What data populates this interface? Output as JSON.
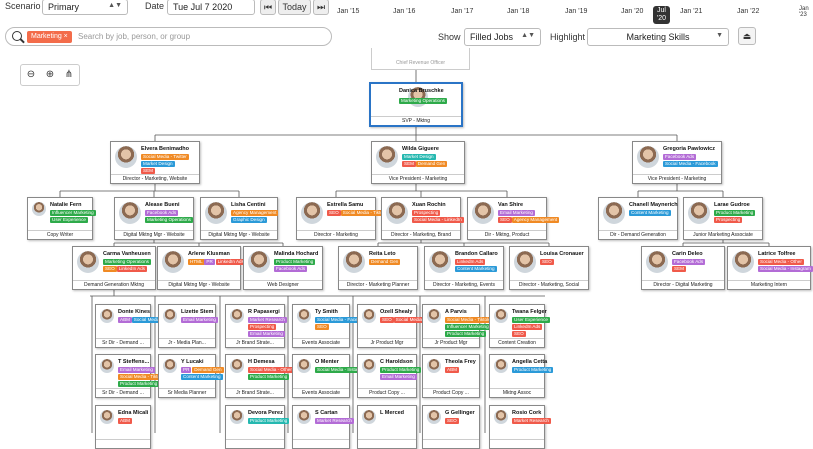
{
  "toolbar": {
    "scenario_label": "Scenario",
    "scenario_value": "Primary",
    "date_label": "Date",
    "date_value": "Tue Jul 7 2020",
    "today_label": "Today"
  },
  "timeline": {
    "ticks": [
      "Jan '15",
      "Jan '16",
      "Jan '17",
      "Jan '18",
      "Jan '19",
      "Jan '20",
      "Jan '21",
      "Jan '22",
      "Jan '23"
    ],
    "current": "Jul '20"
  },
  "search": {
    "tag": "Marketing ×",
    "placeholder": "Search by job, person, or group"
  },
  "show": {
    "label": "Show",
    "value": "Filled Jobs"
  },
  "highlight": {
    "label": "Highlight",
    "value": "Marketing Skills"
  },
  "ghost_title": "Chief Revenue Officer",
  "colors": {
    "green": "#2eaa4a",
    "red": "#f05a4a",
    "orange": "#f08a24",
    "blue": "#2b9ad8",
    "purple": "#b36cd6",
    "teal": "#25b8b0",
    "selected": "#2a74c6"
  },
  "cards": [
    {
      "name": "Danica Bruschke",
      "title": "SVP - Mktng",
      "tags": [
        [
          "Marketing Operations",
          "green"
        ]
      ]
    },
    {
      "name": "Elvera Benimadho",
      "title": "Director - Marketing, Website",
      "tags": [
        [
          "Social Media - Twitter",
          "orange"
        ],
        [
          "Market Design",
          "blue"
        ],
        [
          "SEM",
          "red"
        ]
      ]
    },
    {
      "name": "Wilda Giguere",
      "title": "Vice President - Marketing",
      "tags": [
        [
          "Market Design",
          "teal"
        ],
        [
          "SEM",
          "red"
        ],
        [
          "Demand Gen",
          "orange"
        ]
      ]
    },
    {
      "name": "Gregoria Pawlowicz",
      "title": "Vice President - Marketing",
      "tags": [
        [
          "Facebook Ads",
          "purple"
        ],
        [
          "Social Media - Facebook",
          "blue"
        ]
      ]
    },
    {
      "name": "Natalie Fern",
      "title": "Copy Writer",
      "tags": [
        [
          "Influencer Marketing",
          "green"
        ],
        [
          "User Experience",
          "green"
        ]
      ]
    },
    {
      "name": "Alease Bueni",
      "title": "Digital Mktng Mgr - Website",
      "tags": [
        [
          "Facebook Ads",
          "purple"
        ],
        [
          "Marketing Operations",
          "green"
        ]
      ]
    },
    {
      "name": "Lisha Centini",
      "title": "Digital Mktng Mgr - Website",
      "tags": [
        [
          "Agency Management",
          "orange"
        ],
        [
          "Graphic Design",
          "blue"
        ]
      ]
    },
    {
      "name": "Estrella Samu",
      "title": "Director - Marketing",
      "tags": [
        [
          "SEO",
          "red"
        ],
        [
          "Social Media - Tiktok",
          "orange"
        ]
      ]
    },
    {
      "name": "Xuan Rochin",
      "title": "Director - Marketing, Brand",
      "tags": [
        [
          "Prospecting",
          "red"
        ],
        [
          "Social Media - LinkedIn",
          "red"
        ]
      ]
    },
    {
      "name": "Van Shire",
      "title": "Dir - Mktng, Product",
      "tags": [
        [
          "Email Marketing",
          "purple"
        ],
        [
          "SEO",
          "red"
        ],
        [
          "Agency Management",
          "orange"
        ]
      ]
    },
    {
      "name": "Chanell Maynerich",
      "title": "Dir - Demand Generation",
      "tags": [
        [
          "Content Marketing",
          "blue"
        ]
      ]
    },
    {
      "name": "Larae Gudroe",
      "title": "Junior Marketing Associate",
      "tags": [
        [
          "Product Marketing",
          "green"
        ],
        [
          "Prospecting",
          "red"
        ]
      ]
    },
    {
      "name": "Carma Vanheusen",
      "title": "Demand Generation Mktng",
      "tags": [
        [
          "Marketing Operations",
          "green"
        ],
        [
          "SEO",
          "orange"
        ],
        [
          "LinkedIn Ads",
          "red"
        ]
      ]
    },
    {
      "name": "Arlene Klusman",
      "title": "Digital Mktng Mgr - Website",
      "tags": [
        [
          "HTML",
          "orange"
        ],
        [
          "PR",
          "purple"
        ],
        [
          "LinkedIn Ads",
          "red"
        ]
      ]
    },
    {
      "name": "Malinda Hochard",
      "title": "Web Designer",
      "tags": [
        [
          "Product Marketing",
          "green"
        ],
        [
          "Facebook Ads",
          "purple"
        ]
      ]
    },
    {
      "name": "Reita Leto",
      "title": "Director - Marketing Planner",
      "tags": [
        [
          "Demand Gen",
          "orange"
        ]
      ]
    },
    {
      "name": "Brandon Callaro",
      "title": "Director - Marketing, Events",
      "tags": [
        [
          "LinkedIn Ads",
          "red"
        ],
        [
          "Content Marketing",
          "blue"
        ]
      ]
    },
    {
      "name": "Louisa Cronauer",
      "title": "Director - Marketing, Social",
      "tags": [
        [
          "SEO",
          "red"
        ]
      ]
    },
    {
      "name": "Carin Deleo",
      "title": "Director - Digital Marketing",
      "tags": [
        [
          "Facebook Ads",
          "purple"
        ],
        [
          "SEM",
          "red"
        ]
      ]
    },
    {
      "name": "Latrice Tolfree",
      "title": "Marketing Intern",
      "tags": [
        [
          "Social Media - Other",
          "red"
        ],
        [
          "Social Media - Instagram",
          "purple"
        ]
      ]
    },
    {
      "name": "Donte Kines",
      "title": "Sr Dir - Demand ...",
      "tags": [
        [
          "ABM",
          "purple"
        ],
        [
          "Social Media - Facebook",
          "blue"
        ]
      ]
    },
    {
      "name": "Lizette Stem",
      "title": "Jr - Media Plan...",
      "tags": [
        [
          "Email Marketing",
          "purple"
        ]
      ]
    },
    {
      "name": "R Papasergi",
      "title": "Jr Brand Strate...",
      "tags": [
        [
          "Market Research",
          "purple"
        ],
        [
          "Prospecting",
          "red"
        ],
        [
          "Email Marketing",
          "purple"
        ]
      ]
    },
    {
      "name": "Ty Smith",
      "title": "Events Associate",
      "tags": [
        [
          "Social Media - Facebook",
          "blue"
        ],
        [
          "SEO",
          "orange"
        ]
      ]
    },
    {
      "name": "Ozell Shealy",
      "title": "Jr Product Mgr",
      "tags": [
        [
          "SEO",
          "red"
        ],
        [
          "Social Media - LinkedIn",
          "red"
        ]
      ]
    },
    {
      "name": "A Parvis",
      "title": "Jr Product Mgr",
      "tags": [
        [
          "Social Media - Tiktok",
          "orange"
        ],
        [
          "Influencer Marketing",
          "green"
        ],
        [
          "Product Marketing",
          "green"
        ]
      ]
    },
    {
      "name": "Twana Felger",
      "title": "Content Creation",
      "tags": [
        [
          "User Experience",
          "green"
        ],
        [
          "LinkedIn Ads",
          "red"
        ],
        [
          "SEO",
          "red"
        ]
      ]
    },
    {
      "name": "T Steffens...",
      "title": "Sr Dir - Demand ...",
      "tags": [
        [
          "Email Marketing",
          "purple"
        ],
        [
          "Social Media - Tiktok",
          "orange"
        ],
        [
          "Product Marketing",
          "green"
        ]
      ]
    },
    {
      "name": "Y Lucaki",
      "title": "Sr Media Planner",
      "tags": [
        [
          "PR",
          "purple"
        ],
        [
          "Demand Gen",
          "orange"
        ],
        [
          "Content Marketing",
          "blue"
        ]
      ]
    },
    {
      "name": "H Demesa",
      "title": "Jr Brand Strate...",
      "tags": [
        [
          "Social Media - Other",
          "red"
        ],
        [
          "Product Marketing",
          "green"
        ]
      ]
    },
    {
      "name": "O Menter",
      "title": "Events Associate",
      "tags": [
        [
          "Social Media - Instagram",
          "green"
        ]
      ]
    },
    {
      "name": "C Haroldson",
      "title": "Product Copy ...",
      "tags": [
        [
          "Product Marketing",
          "green"
        ],
        [
          "Email Marketing",
          "purple"
        ]
      ]
    },
    {
      "name": "Theola Frey",
      "title": "Product Copy ...",
      "tags": [
        [
          "ABM",
          "red"
        ]
      ]
    },
    {
      "name": "Angella Cetta",
      "title": "Mktng Assoc",
      "tags": [
        [
          "Product Marketing",
          "blue"
        ]
      ]
    },
    {
      "name": "Edna Micali",
      "title": "",
      "tags": [
        [
          "ABM",
          "red"
        ]
      ]
    },
    {
      "name": "Devora Perez",
      "title": "",
      "tags": [
        [
          "Product Marketing",
          "teal"
        ]
      ]
    },
    {
      "name": "S Cartan",
      "title": "",
      "tags": [
        [
          "Market Research",
          "purple"
        ]
      ]
    },
    {
      "name": "L Merced",
      "title": "",
      "tags": []
    },
    {
      "name": "G Gellinger",
      "title": "",
      "tags": [
        [
          "SEO",
          "red"
        ]
      ]
    },
    {
      "name": "Rosio Cork",
      "title": "",
      "tags": [
        [
          "Market Research",
          "red"
        ]
      ]
    }
  ]
}
